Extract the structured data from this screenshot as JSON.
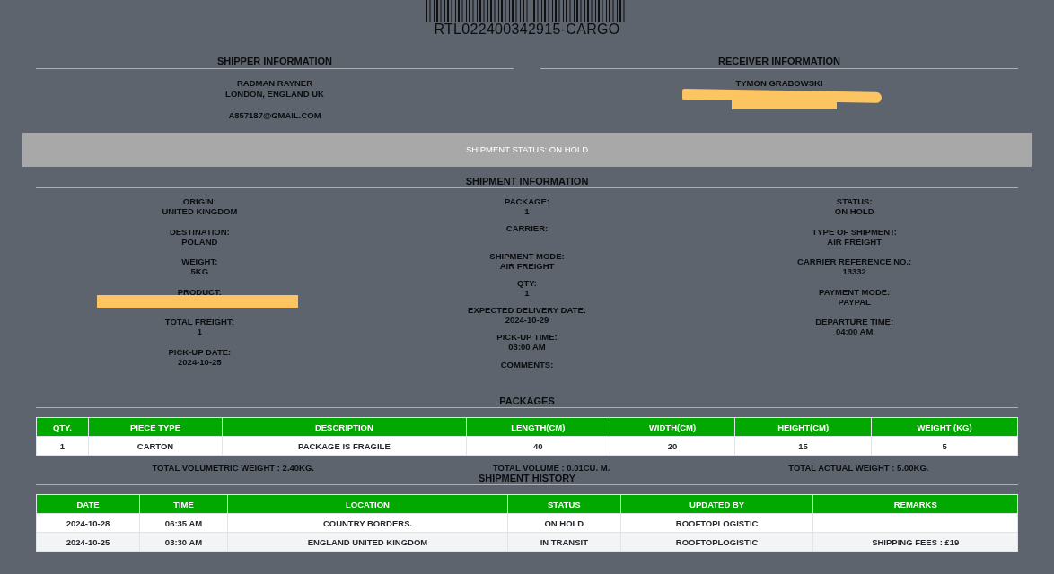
{
  "tracking_code": "RTL022400342915-CARGO",
  "shipper": {
    "heading": "SHIPPER INFORMATION",
    "lines": [
      "RADMAN RAYNER",
      "LONDON, ENGLAND UK"
    ],
    "email": "A857187@GMAIL.COM"
  },
  "receiver": {
    "heading": "RECEIVER INFORMATION",
    "lines": [
      "TYMON GRABOWSKI"
    ]
  },
  "status_banner": "SHIPMENT STATUS: ON HOLD",
  "shipment_information": {
    "heading": "SHIPMENT INFORMATION",
    "columns": [
      [
        {
          "label": "ORIGIN:",
          "value": "UNITED KINGDOM"
        },
        {
          "label": "DESTINATION:",
          "value": "POLAND"
        },
        {
          "label": "WEIGHT:",
          "value": "5KG"
        },
        {
          "label": "PRODUCT:",
          "redacted": true
        },
        {
          "label": "TOTAL FREIGHT:",
          "value": "1"
        },
        {
          "label": "PICK-UP DATE:",
          "value": "2024-10-25"
        }
      ],
      [
        {
          "label": "PACKAGE:",
          "value": "1"
        },
        {
          "label": "CARRIER:"
        },
        {
          "label": "SHIPMENT MODE:",
          "value": "AIR FREIGHT"
        },
        {
          "label": "QTY:",
          "value": "1"
        },
        {
          "label": "EXPECTED DELIVERY DATE:",
          "value": "2024-10-29"
        },
        {
          "label": "PICK-UP TIME:",
          "value": "03:00 AM"
        },
        {
          "label": "COMMENTS:"
        }
      ],
      [
        {
          "label": "STATUS:",
          "value": "ON HOLD"
        },
        {
          "label": "TYPE OF SHIPMENT:",
          "value": "AIR FREIGHT"
        },
        {
          "label": "CARRIER REFERENCE NO.:",
          "value": "13332"
        },
        {
          "label": "PAYMENT MODE:",
          "value": "PAYPAL"
        },
        {
          "label": "DEPARTURE TIME:",
          "value": "04:00 AM"
        }
      ]
    ]
  },
  "packages": {
    "heading": "PACKAGES",
    "columns": [
      "QTY.",
      "PIECE TYPE",
      "DESCRIPTION",
      "LENGTH(CM)",
      "WIDTH(CM)",
      "HEIGHT(CM)",
      "WEIGHT (KG)"
    ],
    "rows": [
      [
        "1",
        "CARTON",
        "PACKAGE IS FRAGILE",
        "40",
        "20",
        "15",
        "5"
      ]
    ],
    "totals": [
      "TOTAL VOLUMETRIC WEIGHT : 2.40KG.",
      "TOTAL VOLUME : 0.01CU. M.",
      "TOTAL ACTUAL WEIGHT : 5.00KG."
    ]
  },
  "shipment_history": {
    "heading": "SHIPMENT HISTORY",
    "columns": [
      "DATE",
      "TIME",
      "LOCATION",
      "STATUS",
      "UPDATED BY",
      "REMARKS"
    ],
    "rows": [
      [
        "2024-10-28",
        "06:35 AM",
        "COUNTRY BORDERS.",
        "ON HOLD",
        "ROOFTOPLOGISTIC",
        ""
      ],
      [
        "2024-10-25",
        "03:30 AM",
        "ENGLAND UNITED KINGDOM",
        "IN TRANSIT",
        "ROOFTOPLOGISTIC",
        "SHIPPING FEES : £19"
      ]
    ]
  }
}
